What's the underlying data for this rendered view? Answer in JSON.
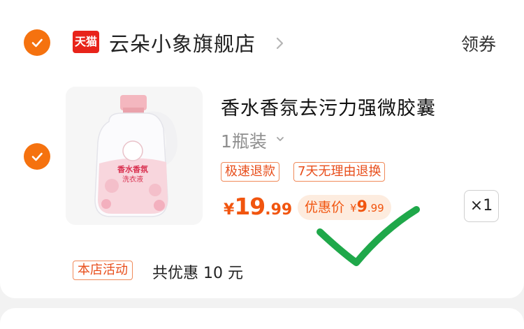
{
  "store": {
    "badge": "天猫",
    "name": "云朵小象旗舰店",
    "coupon_label": "领券"
  },
  "product": {
    "title": "香水香氛去污力强微胶囊",
    "spec": "1瓶装",
    "image_label_line1": "香水香氛",
    "image_label_line2": "洗衣液",
    "tags": [
      "极速退款",
      "7天无理由退换"
    ],
    "price_symbol": "¥",
    "price_integer": "19",
    "price_decimal": ".99",
    "promo_label": "优惠价",
    "promo_symbol": "¥",
    "promo_integer": "9",
    "promo_decimal": ".99",
    "quantity": "×1"
  },
  "activity": {
    "tag": "本店活动",
    "text": "共优惠 10 元"
  },
  "colors": {
    "accent": "#f5720f",
    "price": "#f1550f",
    "tmall": "#e8231a",
    "annotation_check": "#1fa84a"
  },
  "icons": [
    "check-icon",
    "tmall-logo",
    "chevron-right-icon",
    "chevron-down-icon"
  ]
}
